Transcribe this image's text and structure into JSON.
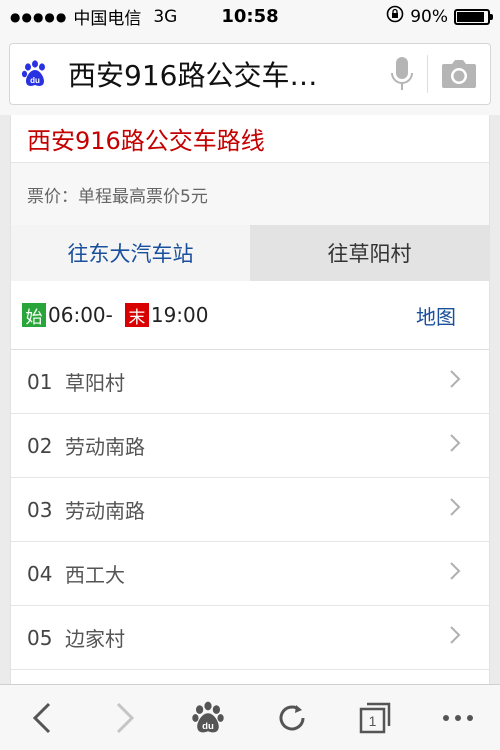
{
  "status_bar": {
    "signal": "●●●●●",
    "carrier": "中国电信",
    "network": "3G",
    "time": "10:58",
    "battery_pct": "90%",
    "battery_level": 0.9
  },
  "search": {
    "query": "西安916路公交车…"
  },
  "route": {
    "title": "西安916路公交车路线",
    "fare": "票价：单程最高票价5元",
    "tabs": [
      {
        "label": "往东大汽车站",
        "active": true
      },
      {
        "label": "往草阳村",
        "active": false
      }
    ],
    "start_tag": "始",
    "start_time": "06:00-",
    "end_tag": "末",
    "end_time": "19:00",
    "map_label": "地图",
    "stops": [
      {
        "num": "01",
        "name": "草阳村"
      },
      {
        "num": "02",
        "name": "劳动南路"
      },
      {
        "num": "03",
        "name": "劳动南路"
      },
      {
        "num": "04",
        "name": "西工大"
      },
      {
        "num": "05",
        "name": "边家村"
      }
    ]
  },
  "toolbar": {
    "tab_count": "1"
  },
  "colors": {
    "title_red": "#c40000",
    "link_blue": "#1a4f9c",
    "start_green": "#2aa53a",
    "end_red": "#d80000",
    "baidu_blue": "#2932e1"
  }
}
